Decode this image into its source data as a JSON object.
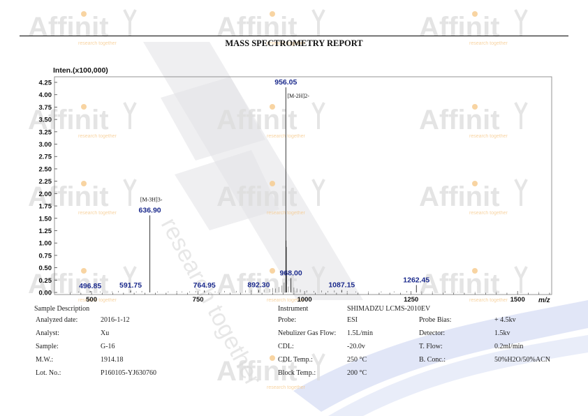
{
  "report": {
    "title": "MASS SPECTROMETRY REPORT"
  },
  "watermark": {
    "brand": "Affinit",
    "tagline": "research together",
    "diagonal_text": "research together",
    "colors": {
      "text": "#dcdcdc",
      "accent": "#f6c98b",
      "bar": "#e2e2e6",
      "blue_band": "#c9d2f0"
    }
  },
  "chart_data": {
    "type": "bar",
    "ylabel": "Inten.(x100,000)",
    "xlabel": "m/z",
    "xlim": [
      413,
      1580
    ],
    "ylim": [
      0,
      4.4
    ],
    "xticks": [
      500,
      750,
      1000,
      1250,
      1500
    ],
    "yticks": [
      "0.00",
      "0.25",
      "0.50",
      "0.75",
      "1.00",
      "1.25",
      "1.50",
      "1.75",
      "2.00",
      "2.25",
      "2.50",
      "2.75",
      "3.00",
      "3.25",
      "3.50",
      "3.75",
      "4.00",
      "4.25"
    ],
    "peaks": [
      {
        "x": 496.85,
        "y": 0.03,
        "label": "496.85"
      },
      {
        "x": 591.75,
        "y": 0.04,
        "label": "591.75"
      },
      {
        "x": 636.9,
        "y": 1.56,
        "label": "636.90",
        "ion": "[M-3H]3-"
      },
      {
        "x": 764.95,
        "y": 0.04,
        "label": "764.95"
      },
      {
        "x": 892.3,
        "y": 0.05,
        "label": "892.30"
      },
      {
        "x": 956.05,
        "y": 4.15,
        "label": "956.05",
        "ion": "[M-2H]2-"
      },
      {
        "x": 956.55,
        "y": 1.05
      },
      {
        "x": 957.05,
        "y": 0.92
      },
      {
        "x": 957.55,
        "y": 0.45
      },
      {
        "x": 968.0,
        "y": 0.29,
        "label": "968.00"
      },
      {
        "x": 1087.15,
        "y": 0.05,
        "label": "1087.15"
      },
      {
        "x": 1262.45,
        "y": 0.15,
        "label": "1262.45"
      }
    ],
    "minor_peaks": [
      {
        "x": 452,
        "y": 0.01
      },
      {
        "x": 470,
        "y": 0.02
      },
      {
        "x": 520,
        "y": 0.02
      },
      {
        "x": 548,
        "y": 0.02
      },
      {
        "x": 563,
        "y": 0.03
      },
      {
        "x": 605,
        "y": 0.02
      },
      {
        "x": 618,
        "y": 0.03
      },
      {
        "x": 655,
        "y": 0.02
      },
      {
        "x": 680,
        "y": 0.02
      },
      {
        "x": 700,
        "y": 0.03
      },
      {
        "x": 712,
        "y": 0.02
      },
      {
        "x": 730,
        "y": 0.02
      },
      {
        "x": 745,
        "y": 0.03
      },
      {
        "x": 790,
        "y": 0.02
      },
      {
        "x": 812,
        "y": 0.03
      },
      {
        "x": 840,
        "y": 0.03
      },
      {
        "x": 861,
        "y": 0.04
      },
      {
        "x": 875,
        "y": 0.05
      },
      {
        "x": 905,
        "y": 0.06
      },
      {
        "x": 918,
        "y": 0.07
      },
      {
        "x": 925,
        "y": 0.09
      },
      {
        "x": 932,
        "y": 0.08
      },
      {
        "x": 940,
        "y": 0.11
      },
      {
        "x": 947,
        "y": 0.14
      },
      {
        "x": 952,
        "y": 0.2
      },
      {
        "x": 962,
        "y": 0.12
      },
      {
        "x": 975,
        "y": 0.1
      },
      {
        "x": 982,
        "y": 0.08
      },
      {
        "x": 990,
        "y": 0.06
      },
      {
        "x": 1005,
        "y": 0.04
      },
      {
        "x": 1022,
        "y": 0.03
      },
      {
        "x": 1040,
        "y": 0.04
      },
      {
        "x": 1055,
        "y": 0.03
      },
      {
        "x": 1070,
        "y": 0.04
      },
      {
        "x": 1100,
        "y": 0.03
      },
      {
        "x": 1120,
        "y": 0.02
      },
      {
        "x": 1150,
        "y": 0.02
      },
      {
        "x": 1180,
        "y": 0.02
      },
      {
        "x": 1210,
        "y": 0.02
      },
      {
        "x": 1240,
        "y": 0.03
      },
      {
        "x": 1275,
        "y": 0.02
      },
      {
        "x": 1300,
        "y": 0.02
      },
      {
        "x": 1330,
        "y": 0.02
      },
      {
        "x": 1360,
        "y": 0.01
      },
      {
        "x": 1400,
        "y": 0.01
      },
      {
        "x": 1450,
        "y": 0.01
      },
      {
        "x": 1500,
        "y": 0.01
      },
      {
        "x": 1550,
        "y": 0.01
      }
    ],
    "colors": {
      "peak": "#222222",
      "label": "#1b2a8c",
      "axis": "#444444",
      "tick_text": "#111111"
    }
  },
  "sample_info": {
    "section_title": "Sample Description",
    "left": [
      {
        "label": "Analyzed date:",
        "value": "2016-1-12"
      },
      {
        "label": "Analyst:",
        "value": "Xu"
      },
      {
        "label": "Sample:",
        "value": "G-16"
      },
      {
        "label": "M.W.:",
        "value": "1914.18"
      },
      {
        "label": "Lot. No.:",
        "value": "P160105-YJ630760"
      }
    ],
    "instrument_label": "Instrument",
    "instrument_value": "SHIMADZU LCMS-2010EV",
    "middle": [
      {
        "label": "Probe:",
        "value": "ESI"
      },
      {
        "label": "Nebulizer Gas Flow:",
        "value": "1.5L/min"
      },
      {
        "label": "CDL:",
        "value": "-20.0v"
      },
      {
        "label": "CDL Temp.:",
        "value": "250 °C"
      },
      {
        "label": "Block Temp.:",
        "value": "200 °C"
      }
    ],
    "right": [
      {
        "label": "Probe Bias:",
        "value": "+ 4.5kv"
      },
      {
        "label": "Detector:",
        "value": "1.5kv"
      },
      {
        "label": "T. Flow:",
        "value": "0.2ml/min"
      },
      {
        "label": "B. Conc.:",
        "value": "50%H2O/50%ACN"
      }
    ]
  }
}
